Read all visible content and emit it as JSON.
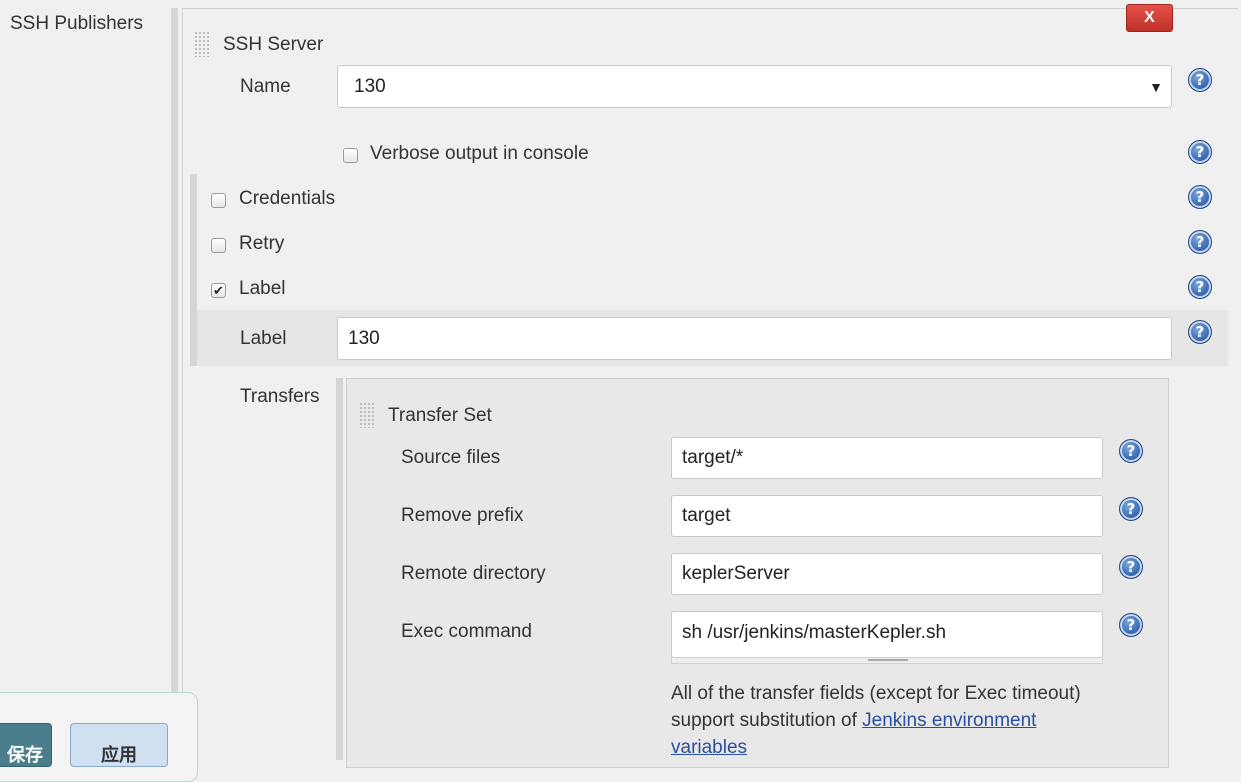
{
  "sidebar": {
    "section_label": "SSH Publishers"
  },
  "ssh_server": {
    "heading": "SSH Server",
    "close_label": "X",
    "name_label": "Name",
    "name_value": "130",
    "verbose_label": "Verbose output in console",
    "verbose_checked": false,
    "credentials_label": "Credentials",
    "credentials_checked": false,
    "retry_label": "Retry",
    "retry_checked": false,
    "label_checkbox_label": "Label",
    "label_checked": true,
    "label_field_label": "Label",
    "label_value": "130",
    "help_glyph": "?"
  },
  "transfers": {
    "label": "Transfers",
    "set_heading": "Transfer Set",
    "source_files_label": "Source files",
    "source_files_value": "target/*",
    "remove_prefix_label": "Remove prefix",
    "remove_prefix_value": "target",
    "remote_directory_label": "Remote directory",
    "remote_directory_value": "keplerServer",
    "exec_command_label": "Exec command",
    "exec_command_value": "sh /usr/jenkins/masterKepler.sh",
    "note_text": "All of the transfer fields (except for Exec timeout) support substitution of ",
    "note_link": "Jenkins environment variables"
  },
  "footer": {
    "save_label": "保存",
    "apply_label": "应用"
  },
  "icons": {
    "help": "help-icon",
    "check": "check-icon",
    "grip": "drag-handle-icon",
    "arrow": "dropdown-arrow-icon"
  },
  "colors": {
    "close_red": "#d9403a",
    "help_blue": "#3c6db8",
    "save_teal": "#4a7e8d",
    "apply_blue": "#cfe0f1",
    "link": "#2b4f9c"
  }
}
